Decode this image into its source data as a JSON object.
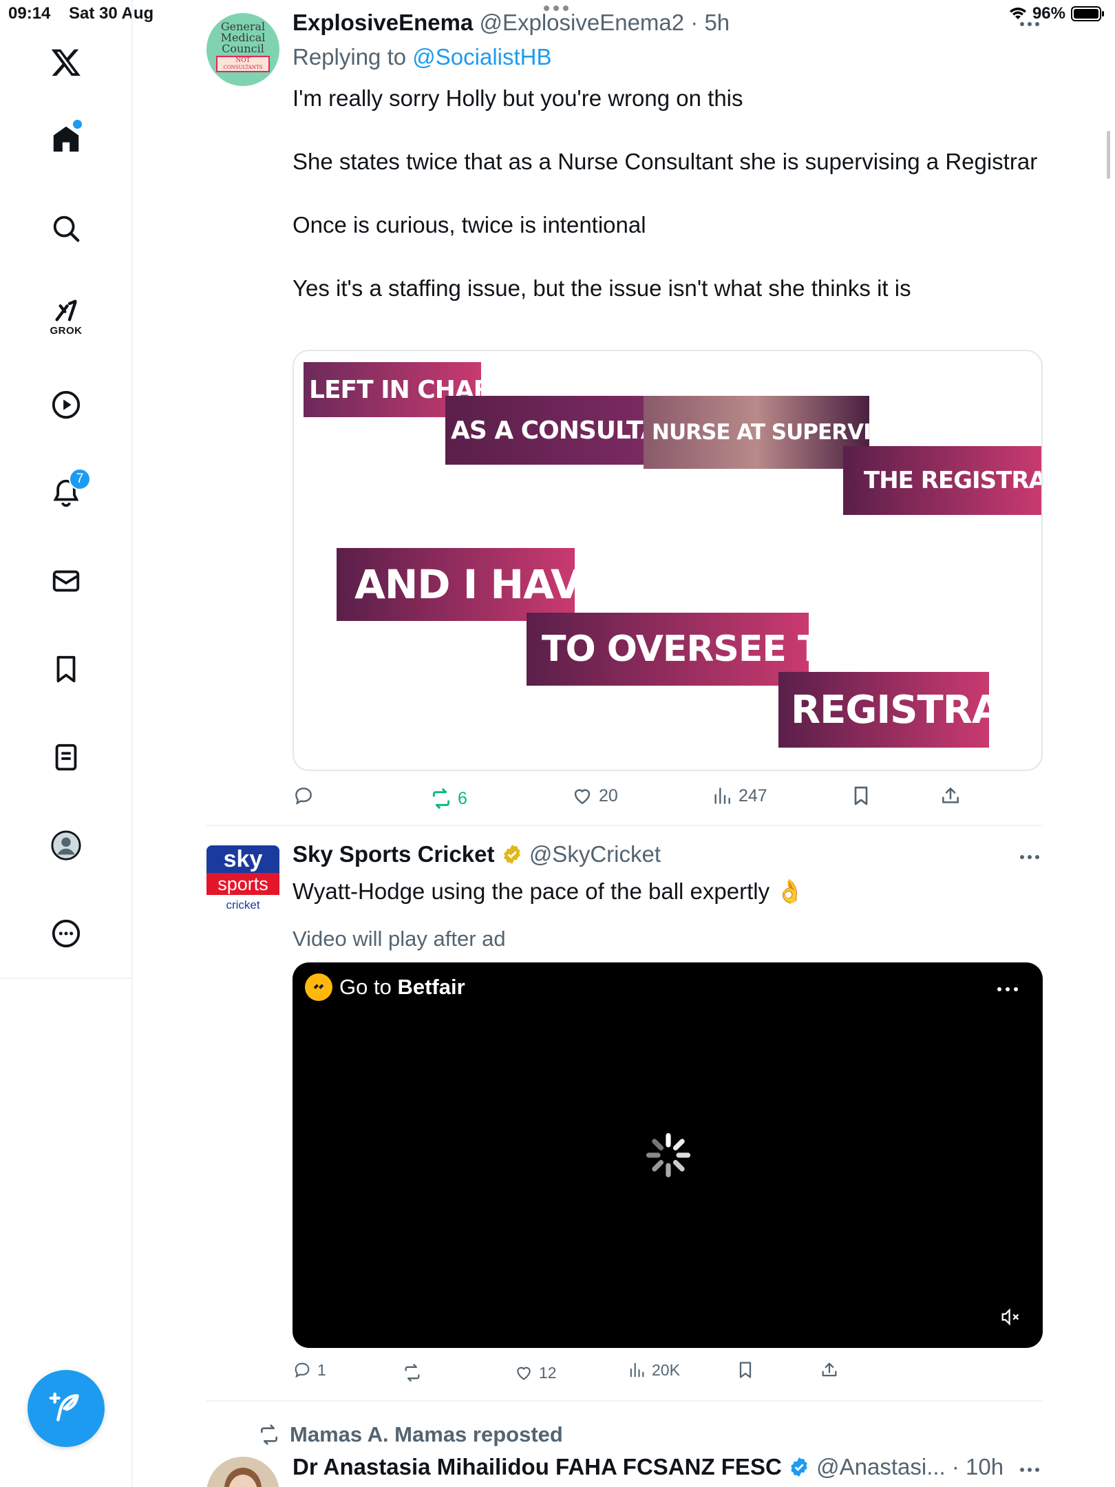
{
  "status_bar": {
    "time": "09:14",
    "date": "Sat 30 Aug",
    "battery": "96%"
  },
  "sidebar": {
    "grok_label": "GROK",
    "notifications_count": "7",
    "accent_color": "#1d9bf0"
  },
  "tweets": [
    {
      "name": "ExplosiveEnema",
      "handle": "@ExplosiveEnema2",
      "time": "· 5h",
      "reply_prefix": "Replying to ",
      "reply_to": "@SocialistHB",
      "text": "I'm really sorry Holly but you're wrong on this\n\nShe states twice that as a Nurse Consultant she is supervising a Registrar\n\nOnce is curious, twice is intentional\n\nYes it's a staffing issue, but the issue isn't what she thinks it is",
      "avatar_text": [
        "General",
        "Medical",
        "Council",
        "NOT",
        "CONSULTANTS"
      ],
      "media_captions": [
        "LEFT IN CHARGE",
        "AS A CONSULTANT",
        "NURSE AT SUPERVISING",
        "THE REGISTRAR",
        "AND I HAVE",
        "TO OVERSEE THE",
        "REGISTRAR"
      ],
      "stats": {
        "replies": "",
        "reposts": "6",
        "likes": "20",
        "views": "247"
      }
    },
    {
      "name": "Sky Sports Cricket",
      "handle": "@SkyCricket",
      "verified": "gold",
      "text": "Wyatt-Hodge using the pace of the ball expertly 👌",
      "avatar_text": [
        "sky",
        "sports",
        "cricket"
      ],
      "ad_label": "Video will play after ad",
      "video_brand_prefix": "Go to ",
      "video_brand_name": "Betfair",
      "stats": {
        "replies": "1",
        "reposts": "",
        "likes": "12",
        "views": "20K"
      }
    },
    {
      "reposted_by": "Mamas A. Mamas reposted",
      "name": "Dr Anastasia Mihailidou FAHA FCSANZ FESC",
      "handle": "@Anastasi...",
      "time": "· 10h",
      "verified": "blue"
    }
  ]
}
